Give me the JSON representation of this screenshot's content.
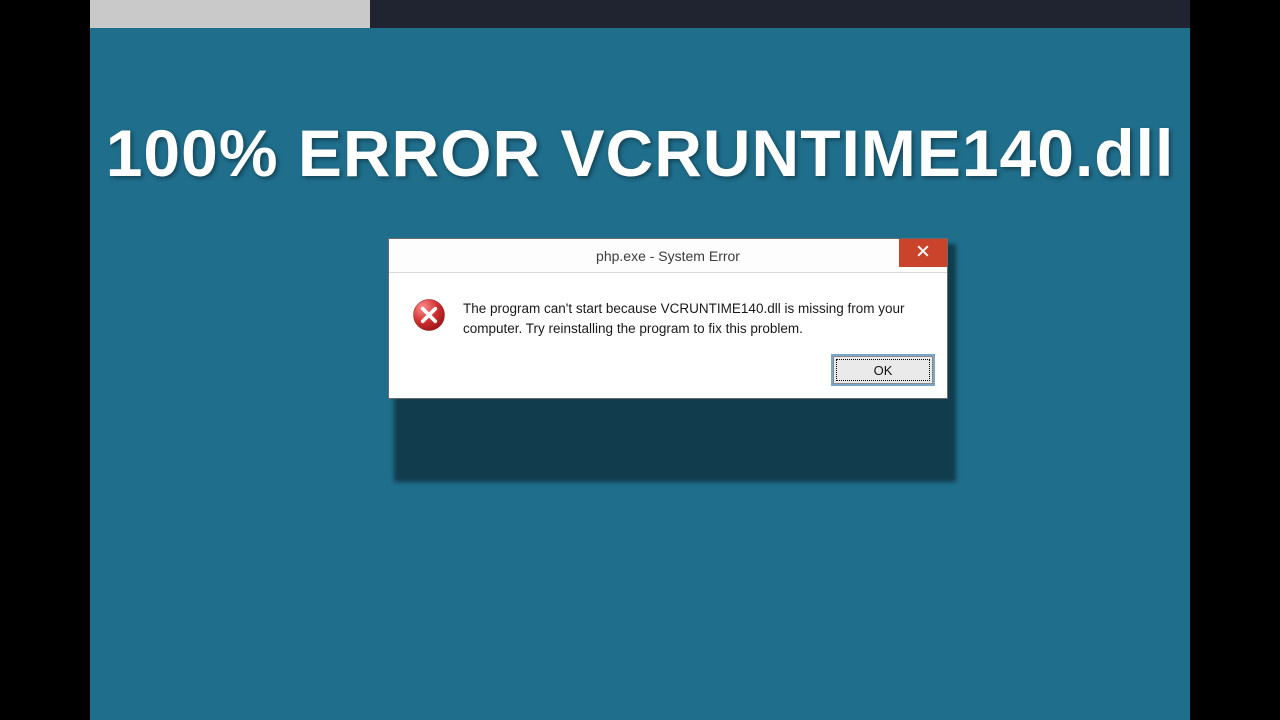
{
  "headline": "100% ERROR VCRUNTIME140.dll",
  "dialog": {
    "title": "php.exe - System Error",
    "message": "The program can't start because VCRUNTIME140.dll is missing from your computer. Try reinstalling the program to fix this problem.",
    "ok_label": "OK"
  },
  "colors": {
    "background": "#1f6e8c",
    "close_button": "#c9442b"
  }
}
